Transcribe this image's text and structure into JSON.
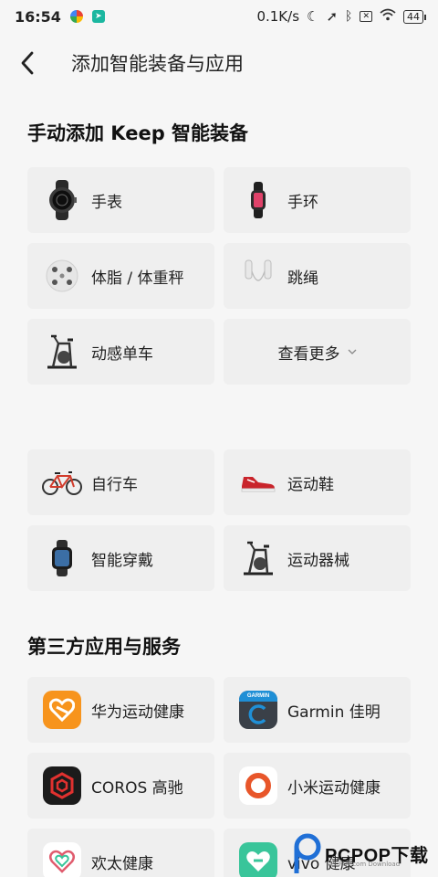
{
  "status_bar": {
    "time": "16:54",
    "network_speed": "0.1K/s",
    "battery": "44"
  },
  "header": {
    "title": "添加智能装备与应用"
  },
  "manual_section": {
    "title": "手动添加 Keep 智能装备",
    "items": [
      {
        "label": "手表",
        "icon": "smartwatch-icon"
      },
      {
        "label": "手环",
        "icon": "band-icon"
      },
      {
        "label": "体脂 / 体重秤",
        "icon": "scale-icon"
      },
      {
        "label": "跳绳",
        "icon": "jump-rope-icon"
      },
      {
        "label": "动感单车",
        "icon": "spin-bike-icon"
      }
    ],
    "more_label": "查看更多"
  },
  "other_devices": {
    "items": [
      {
        "label": "自行车",
        "icon": "bicycle-icon"
      },
      {
        "label": "运动鞋",
        "icon": "sneaker-icon"
      },
      {
        "label": "智能穿戴",
        "icon": "wearable-icon"
      },
      {
        "label": "运动器械",
        "icon": "exercise-equipment-icon"
      }
    ]
  },
  "third_party_section": {
    "title": "第三方应用与服务",
    "items": [
      {
        "label": "华为运动健康",
        "icon": "huawei-health-icon",
        "color": "#f7941d"
      },
      {
        "label": "Garmin 佳明",
        "icon": "garmin-icon",
        "color": "#3a4048"
      },
      {
        "label": "COROS 高驰",
        "icon": "coros-icon",
        "color": "#1b1b1b"
      },
      {
        "label": "小米运动健康",
        "icon": "mi-fitness-icon",
        "color": "#e8562a"
      },
      {
        "label": "欢太健康",
        "icon": "heytap-health-icon",
        "color": "#e05c6e"
      },
      {
        "label": "vivo 健康",
        "icon": "vivo-health-icon",
        "color": "#39c59a"
      }
    ]
  },
  "watermark": {
    "brand": "PCPOP下载",
    "sub": "PCPOP.com Download"
  }
}
